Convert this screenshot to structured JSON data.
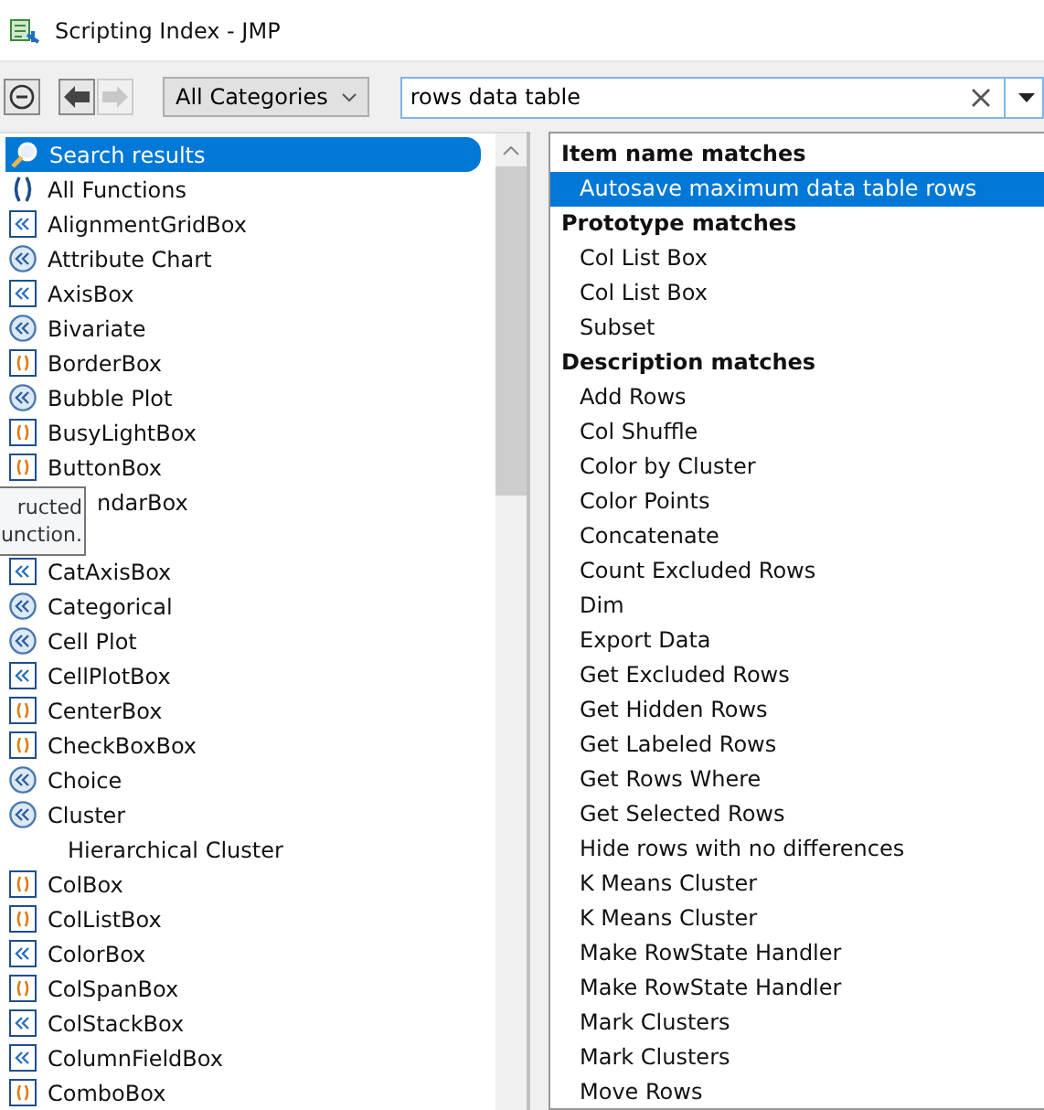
{
  "window": {
    "title": "Scripting Index - JMP"
  },
  "toolbar": {
    "category": "All Categories",
    "search": {
      "value": "rows data table"
    },
    "back_disabled": false,
    "forward_disabled": true
  },
  "sidebar": {
    "items": [
      {
        "label": "Search results",
        "kind": "search",
        "selected": true
      },
      {
        "label": "All Functions",
        "kind": "parens",
        "selected": false
      },
      {
        "label": "AlignmentGridBox",
        "kind": "box",
        "selected": false
      },
      {
        "label": "Attribute Chart",
        "kind": "circle",
        "selected": false
      },
      {
        "label": "AxisBox",
        "kind": "box",
        "selected": false
      },
      {
        "label": "Bivariate",
        "kind": "circle",
        "selected": false
      },
      {
        "label": "BorderBox",
        "kind": "orange",
        "selected": false
      },
      {
        "label": "Bubble Plot",
        "kind": "circle",
        "selected": false
      },
      {
        "label": "BusyLightBox",
        "kind": "orange",
        "selected": false
      },
      {
        "label": "ButtonBox",
        "kind": "orange",
        "selected": false
      },
      {
        "label": "ndarBox",
        "kind": "covered",
        "selected": false
      },
      {
        "kind": "blank",
        "selected": false
      },
      {
        "label": "CatAxisBox",
        "kind": "box",
        "selected": false
      },
      {
        "label": "Categorical",
        "kind": "circle",
        "selected": false
      },
      {
        "label": "Cell Plot",
        "kind": "circle",
        "selected": false
      },
      {
        "label": "CellPlotBox",
        "kind": "box",
        "selected": false
      },
      {
        "label": "CenterBox",
        "kind": "orange",
        "selected": false
      },
      {
        "label": "CheckBoxBox",
        "kind": "orange",
        "selected": false
      },
      {
        "label": "Choice",
        "kind": "circle",
        "selected": false
      },
      {
        "label": "Cluster",
        "kind": "circle",
        "selected": false,
        "children": [
          {
            "label": "Hierarchical Cluster",
            "selected": false
          }
        ]
      },
      {
        "label": "ColBox",
        "kind": "orange",
        "selected": false
      },
      {
        "label": "ColListBox",
        "kind": "orange",
        "selected": false
      },
      {
        "label": "ColorBox",
        "kind": "box",
        "selected": false
      },
      {
        "label": "ColSpanBox",
        "kind": "orange",
        "selected": false
      },
      {
        "label": "ColStackBox",
        "kind": "box",
        "selected": false
      },
      {
        "label": "ColumnFieldBox",
        "kind": "box",
        "selected": false
      },
      {
        "label": "ComboBox",
        "kind": "orange",
        "selected": false
      }
    ]
  },
  "tooltip": {
    "lines": [
      "ructed",
      "unction."
    ]
  },
  "results": [
    {
      "kind": "header",
      "label": "Item name matches",
      "selected": false
    },
    {
      "kind": "item",
      "label": "Autosave maximum data table rows",
      "selected": true
    },
    {
      "kind": "header",
      "label": "Prototype matches",
      "selected": false
    },
    {
      "kind": "item",
      "label": "Col List Box",
      "selected": false
    },
    {
      "kind": "item",
      "label": "Col List Box",
      "selected": false
    },
    {
      "kind": "item",
      "label": "Subset",
      "selected": false
    },
    {
      "kind": "header",
      "label": "Description matches",
      "selected": false
    },
    {
      "kind": "item",
      "label": "Add Rows",
      "selected": false
    },
    {
      "kind": "item",
      "label": "Col Shuffle",
      "selected": false
    },
    {
      "kind": "item",
      "label": "Color by Cluster",
      "selected": false
    },
    {
      "kind": "item",
      "label": "Color Points",
      "selected": false
    },
    {
      "kind": "item",
      "label": "Concatenate",
      "selected": false
    },
    {
      "kind": "item",
      "label": "Count Excluded Rows",
      "selected": false
    },
    {
      "kind": "item",
      "label": "Dim",
      "selected": false
    },
    {
      "kind": "item",
      "label": "Export Data",
      "selected": false
    },
    {
      "kind": "item",
      "label": "Get Excluded Rows",
      "selected": false
    },
    {
      "kind": "item",
      "label": "Get Hidden Rows",
      "selected": false
    },
    {
      "kind": "item",
      "label": "Get Labeled Rows",
      "selected": false
    },
    {
      "kind": "item",
      "label": "Get Rows Where",
      "selected": false
    },
    {
      "kind": "item",
      "label": "Get Selected Rows",
      "selected": false
    },
    {
      "kind": "item",
      "label": "Hide rows with no differences",
      "selected": false
    },
    {
      "kind": "item",
      "label": "K Means Cluster",
      "selected": false
    },
    {
      "kind": "item",
      "label": "K Means Cluster",
      "selected": false
    },
    {
      "kind": "item",
      "label": "Make RowState Handler",
      "selected": false
    },
    {
      "kind": "item",
      "label": "Make RowState Handler",
      "selected": false
    },
    {
      "kind": "item",
      "label": "Mark Clusters",
      "selected": false
    },
    {
      "kind": "item",
      "label": "Mark Clusters",
      "selected": false
    },
    {
      "kind": "item",
      "label": "Move Rows",
      "selected": false
    }
  ]
}
